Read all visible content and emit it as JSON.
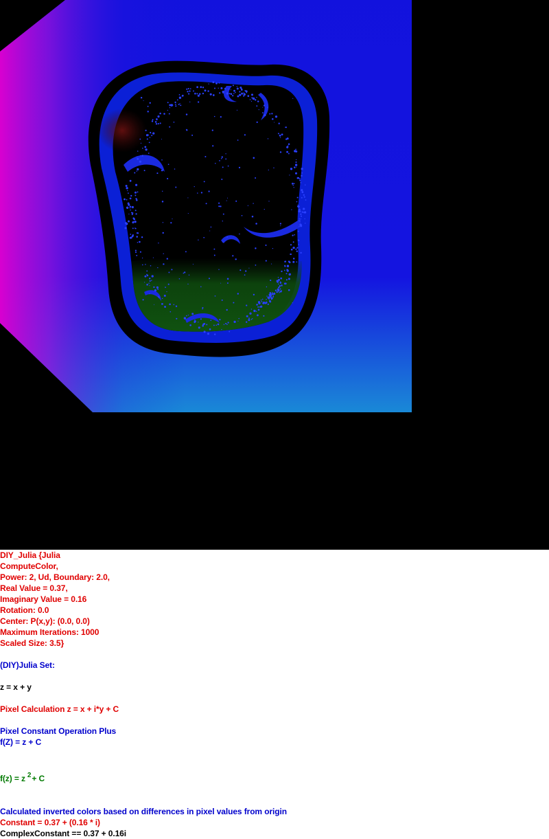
{
  "canvas": {
    "background": "#000000",
    "render_colors": {
      "outer_blue": "#1414e0",
      "magenta": "#d400d4",
      "cyan": "#14d4d0",
      "inner_blue": "#0a20d8",
      "deep_red": "#5a0c0c",
      "green": "#0e4a0e"
    }
  },
  "info": {
    "header_lines": [
      "DIY_Julia {Julia",
      "ComputeColor,",
      "Power: 2, Ud, Boundary: 2.0,",
      "Real Value = 0.37,",
      "Imaginary Value = 0.16",
      "Rotation: 0.0",
      "Center: P(x,y): (0.0, 0.0)",
      "Maximum Iterations: 1000",
      "Scaled Size: 3.5}"
    ],
    "set_title": "(DIY)Julia Set:",
    "z_def": "z = x + y",
    "pixel_calc": "Pixel Calculation z = x + i*y + C",
    "operation_title": "Pixel Constant Operation Plus",
    "operation_formula": "f(Z) = z + C",
    "power_formula": {
      "prefix": "f(z) = z",
      "exponent": "2",
      "suffix": "+ C"
    },
    "color_note": "Calculated inverted colors based on differences in pixel values from origin",
    "constant_line": "Constant = 0.37 + (0.16 * i)",
    "complex_constant_line": "ComplexConstant == 0.37 + 0.16i"
  }
}
